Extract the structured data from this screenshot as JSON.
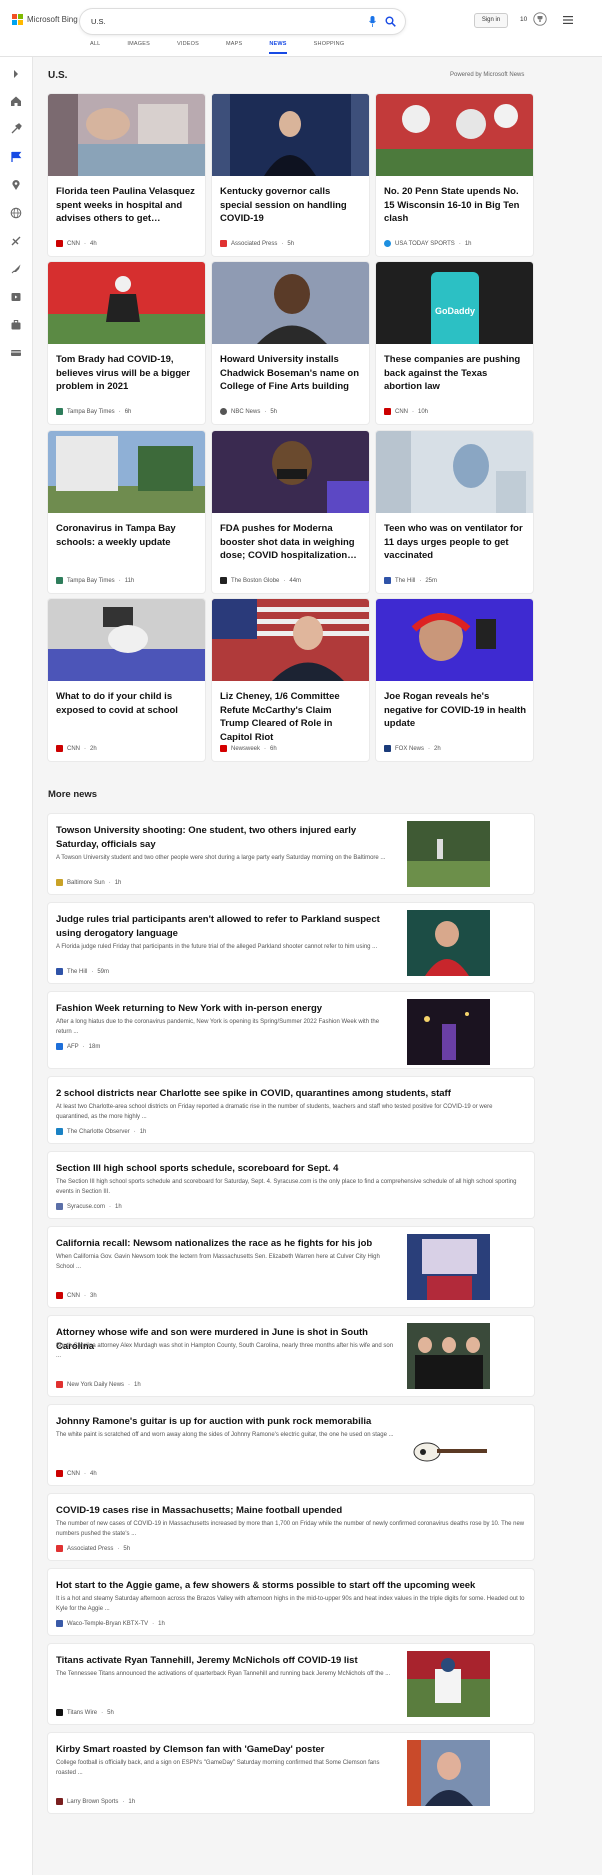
{
  "header": {
    "logo_text": "Microsoft Bing",
    "query": "U.S.",
    "signin": "Sign in",
    "rewards": "10",
    "tabs": [
      "ALL",
      "IMAGES",
      "VIDEOS",
      "MAPS",
      "NEWS",
      "SHOPPING"
    ]
  },
  "section": {
    "title": "U.S.",
    "powered": "Powered by Microsoft News"
  },
  "cards": [
    {
      "title": "Florida teen Paulina Velasquez spent weeks in hospital and advises others to get…",
      "source": "CNN",
      "time": "4h"
    },
    {
      "title": "Kentucky governor calls special session on handling COVID-19",
      "source": "Associated Press",
      "time": "5h"
    },
    {
      "title": "No. 20 Penn State upends No. 15 Wisconsin 16-10 in Big Ten clash",
      "source": "USA TODAY SPORTS",
      "time": "1h"
    },
    {
      "title": "Tom Brady had COVID-19, believes virus will be a bigger problem in 2021",
      "source": "Tampa Bay Times",
      "time": "6h"
    },
    {
      "title": "Howard University installs Chadwick Boseman's name on College of Fine Arts building",
      "source": "NBC News",
      "time": "5h"
    },
    {
      "title": "These companies are pushing back against the Texas abortion law",
      "source": "CNN",
      "time": "10h"
    },
    {
      "title": "Coronavirus in Tampa Bay schools: a weekly update",
      "source": "Tampa Bay Times",
      "time": "11h"
    },
    {
      "title": "FDA pushes for Moderna booster shot data in weighing dose; COVID hospitalization…",
      "source": "The Boston Globe",
      "time": "44m"
    },
    {
      "title": "Teen who was on ventilator for 11 days urges people to get vaccinated",
      "source": "The Hill",
      "time": "25m"
    },
    {
      "title": "What to do if your child is exposed to covid at school",
      "source": "CNN",
      "time": "2h"
    },
    {
      "title": "Liz Cheney, 1/6 Committee Refute McCarthy's Claim Trump Cleared of Role in Capitol Riot",
      "source": "Newsweek",
      "time": "6h"
    },
    {
      "title": "Joe Rogan reveals he's negative for COVID-19 in health update",
      "source": "FOX News",
      "time": "2h"
    }
  ],
  "more_news_title": "More news",
  "more_news": [
    {
      "title": "Towson University shooting: One student, two others injured early Saturday, officials say",
      "snippet": "A Towson University student and two other people were shot during a large party early Saturday morning on the Baltimore ...",
      "source": "Baltimore Sun",
      "time": "1h"
    },
    {
      "title": "Judge rules trial participants aren't allowed to refer to Parkland suspect using derogatory language",
      "snippet": "A Florida judge ruled Friday that participants in the future trial of the alleged Parkland shooter cannot refer to him using ...",
      "source": "The Hill",
      "time": "59m"
    },
    {
      "title": "Fashion Week returning to New York with in-person energy",
      "snippet": "After a long hiatus due to the coronavirus pandemic, New York is opening its Spring/Summer 2022 Fashion Week with the return ...",
      "source": "AFP",
      "time": "18m"
    },
    {
      "title": "2 school districts near Charlotte see spike in COVID, quarantines among students, staff",
      "snippet": "At least two Charlotte-area school districts on Friday reported a dramatic rise in the number of students, teachers and staff who tested positive for COVID-19 or were quarantined, as the more highly ...",
      "source": "The Charlotte Observer",
      "time": "1h"
    },
    {
      "title": "Section III high school sports schedule, scoreboard for Sept. 4",
      "snippet": "The Section III high school sports schedule and scoreboard for Saturday, Sept. 4. Syracuse.com is the only place to find a comprehensive schedule of all high school sporting events in Section III.",
      "source": "Syracuse.com",
      "time": "1h"
    },
    {
      "title": "California recall: Newsom nationalizes the race as he fights for his job",
      "snippet": "When California Gov. Gavin Newsom took the lectern from Massachusetts Sen. Elizabeth Warren here at Culver City High School ...",
      "source": "CNN",
      "time": "3h"
    },
    {
      "title": "Attorney whose wife and son were murdered in June is shot in South Carolina",
      "snippet": "South Carolina attorney Alex Murdagh was shot in Hampton County, South Carolina, nearly three months after his wife and son ...",
      "source": "New York Daily News",
      "time": "1h"
    },
    {
      "title": "Johnny Ramone's guitar is up for auction with punk rock memorabilia",
      "snippet": "The white paint is scratched off and worn away along the sides of Johnny Ramone's electric guitar, the one he used on stage ...",
      "source": "CNN",
      "time": "4h"
    },
    {
      "title": "COVID-19 cases rise in Massachusetts; Maine football upended",
      "snippet": "The number of new cases of COVID-19 in Massachusetts increased by more than 1,700 on Friday while the number of newly confirmed coronavirus deaths rose by 10. The new numbers pushed the state's ...",
      "source": "Associated Press",
      "time": "5h"
    },
    {
      "title": "Hot start to the Aggie game, a few showers & storms possible to start off the upcoming week",
      "snippet": "It is a hot and steamy Saturday afternoon across the Brazos Valley with afternoon highs in the mid-to-upper 90s and heat index values in the triple digits for some. Headed out to Kyle for the Aggie ...",
      "source": "Waco-Temple-Bryan KBTX-TV",
      "time": "1h"
    },
    {
      "title": "Titans activate Ryan Tannehill, Jeremy McNichols off COVID-19 list",
      "snippet": "The Tennessee Titans announced the activations of quarterback Ryan Tannehill and running back Jeremy McNichols off the ...",
      "source": "Titans Wire",
      "time": "5h"
    },
    {
      "title": "Kirby Smart roasted by Clemson fan with 'GameDay' poster",
      "snippet": "College football is officially back, and a sign on ESPN's \"GameDay\" Saturday morning confirmed that Some Clemson fans roasted ...",
      "source": "Larry Brown Sports",
      "time": "1h"
    }
  ]
}
